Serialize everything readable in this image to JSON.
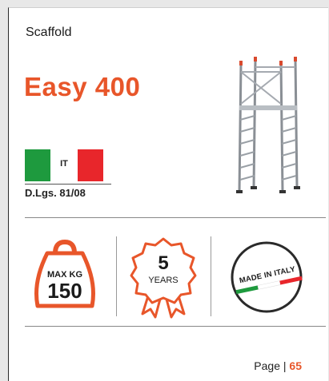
{
  "header": {
    "category": "Scaffold",
    "title": "Easy 400"
  },
  "origin": {
    "country_code": "IT",
    "regulation": "D.Lgs. 81/08"
  },
  "badges": {
    "weight": {
      "top": "MAX KG",
      "value": "150"
    },
    "warranty": {
      "value": "5",
      "unit": "YEARS"
    },
    "made": {
      "text": "MADE IN ITALY"
    }
  },
  "footer": {
    "page_label": "Page",
    "separator": "|",
    "page_number": "65"
  },
  "colors": {
    "accent": "#e8562a",
    "italy_green": "#1e9a3e",
    "italy_red": "#e8262b"
  }
}
